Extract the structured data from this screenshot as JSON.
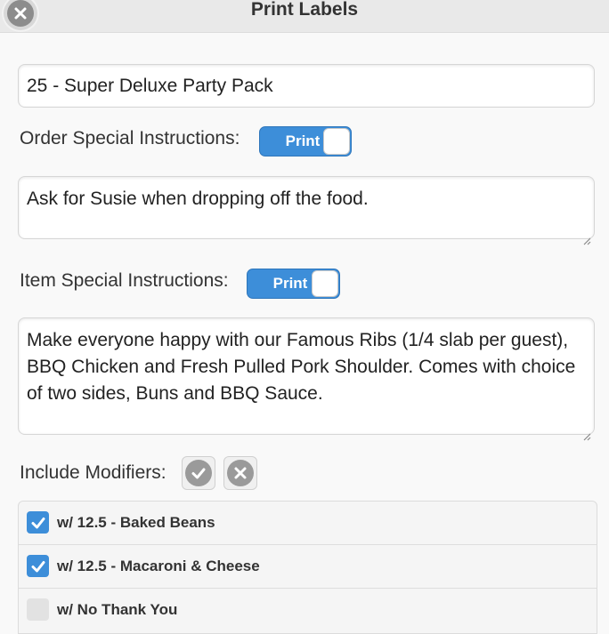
{
  "header": {
    "title": "Print Labels"
  },
  "title_field": {
    "value": "25 - Super Deluxe Party Pack"
  },
  "order_instructions": {
    "label": "Order Special Instructions:",
    "toggle_label": "Print",
    "value": "Ask for Susie when dropping off the food."
  },
  "item_instructions": {
    "label": "Item Special Instructions:",
    "toggle_label": "Print",
    "value": "Make everyone happy with our Famous Ribs (1/4 slab per guest), BBQ Chicken and Fresh Pulled Pork Shoulder. Comes with choice of two sides, Buns and BBQ Sauce."
  },
  "modifiers": {
    "label": "Include Modifiers:",
    "items": [
      {
        "label": "w/ 12.5 - Baked Beans",
        "checked": true
      },
      {
        "label": "w/ 12.5 - Macaroni & Cheese",
        "checked": true
      },
      {
        "label": "w/ No Thank You",
        "checked": false
      }
    ]
  },
  "colors": {
    "accent": "#3d8ed9",
    "header_bg": "#e9e9e9"
  },
  "icons": {
    "close": "close-icon",
    "select_all": "checkmark-icon",
    "deselect_all": "close-icon",
    "checkbox": "checkmark-icon",
    "resize": "resize-grip-icon"
  }
}
